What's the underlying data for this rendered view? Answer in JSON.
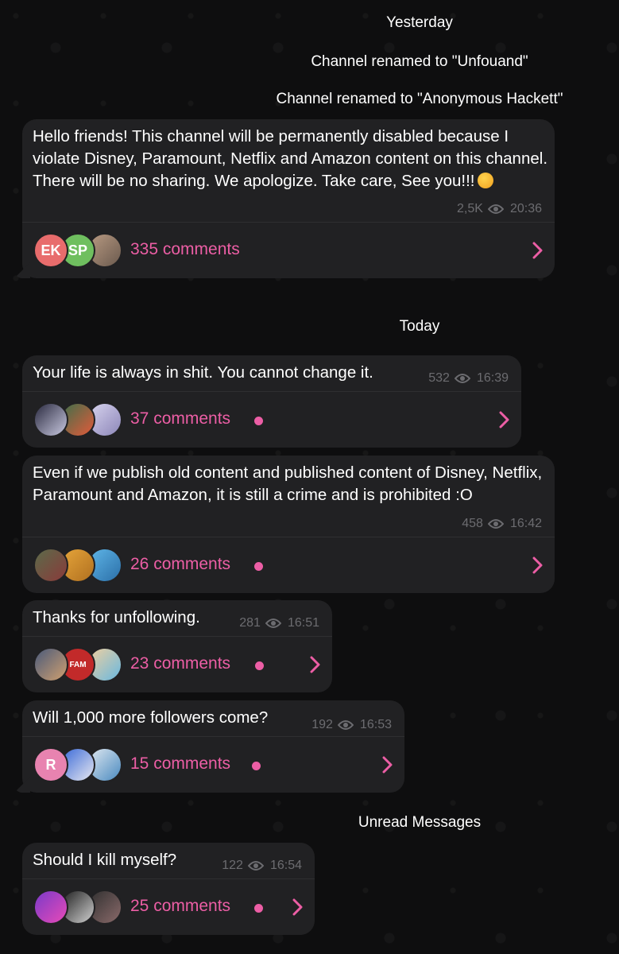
{
  "dates": {
    "yesterday": "Yesterday",
    "today": "Today",
    "unread": "Unread Messages"
  },
  "service_messages": {
    "rename_1": "Channel renamed to \"Unfouand\"",
    "rename_2": "Channel renamed to \"Anonymous Hackett\""
  },
  "messages": [
    {
      "text": "Hello friends! This channel will be permanently disabled because I violate Disney, Paramount, Netflix and Amazon content on this channel. There will be no sharing. We apologize. Take care, See you!!!",
      "emoji": "sad-face-emoji",
      "views": "2,5K",
      "time": "20:36",
      "comments": "335 comments",
      "avatars": [
        "EK",
        "SP",
        ""
      ],
      "unread_dot": false
    },
    {
      "text": "Your life is always in shit. You cannot change it.",
      "views": "532",
      "time": "16:39",
      "comments": "37 comments",
      "avatars": [
        "",
        "",
        ""
      ],
      "unread_dot": true
    },
    {
      "text": "Even if we publish old content and published content of Disney, Netflix, Paramount and Amazon, it is still a crime and is prohibited :O",
      "views": "458",
      "time": "16:42",
      "comments": "26 comments",
      "avatars": [
        "",
        "",
        ""
      ],
      "unread_dot": true
    },
    {
      "text": "Thanks for unfollowing.",
      "views": "281",
      "time": "16:51",
      "comments": "23 comments",
      "avatars": [
        "",
        "FAM",
        ""
      ],
      "unread_dot": true
    },
    {
      "text": "Will 1,000 more followers come?",
      "views": "192",
      "time": "16:53",
      "comments": "15 comments",
      "avatars": [
        "R",
        "",
        ""
      ],
      "unread_dot": true
    },
    {
      "text": "Should I kill myself?",
      "views": "122",
      "time": "16:54",
      "comments": "25 comments",
      "avatars": [
        "",
        "",
        ""
      ],
      "unread_dot": true
    }
  ],
  "colors": {
    "background": "#0e0e0f",
    "bubble": "#212123",
    "accent": "#ec5ea5",
    "meta": "#6c6c70",
    "text": "#ffffff"
  }
}
